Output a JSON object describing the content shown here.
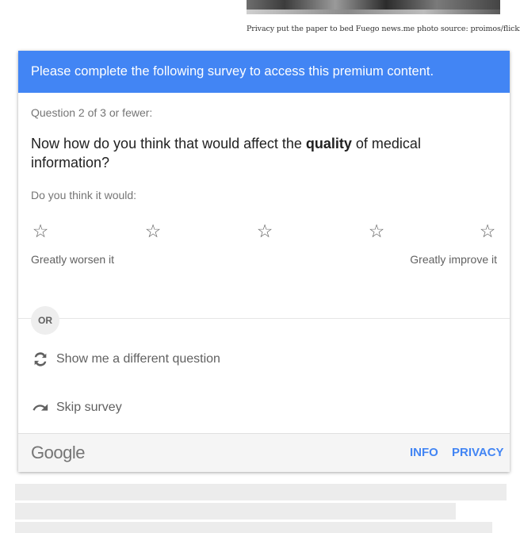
{
  "photo": {
    "caption": "Privacy put the paper to bed Fuego news.me photo source: proimos/flickr"
  },
  "survey": {
    "header": "Please complete the following survey to access this premium content.",
    "question_count": "Question 2 of 3 or fewer:",
    "question_before": "Now how do you think that would affect the ",
    "question_bold": "quality",
    "question_after": " of medical information?",
    "prompt": "Do you think it would:",
    "rating": {
      "options": 5,
      "selected": 0,
      "star_icon": "star-outline-icon"
    },
    "scale_low": "Greatly worsen it",
    "scale_high": "Greatly improve it",
    "or_label": "OR",
    "different_question": "Show me a different question",
    "skip": "Skip survey",
    "footer": {
      "logo": "Google",
      "info": "INFO",
      "privacy": "PRIVACY"
    }
  },
  "colors": {
    "accent": "#4285f4",
    "placeholder": "#ececec"
  }
}
